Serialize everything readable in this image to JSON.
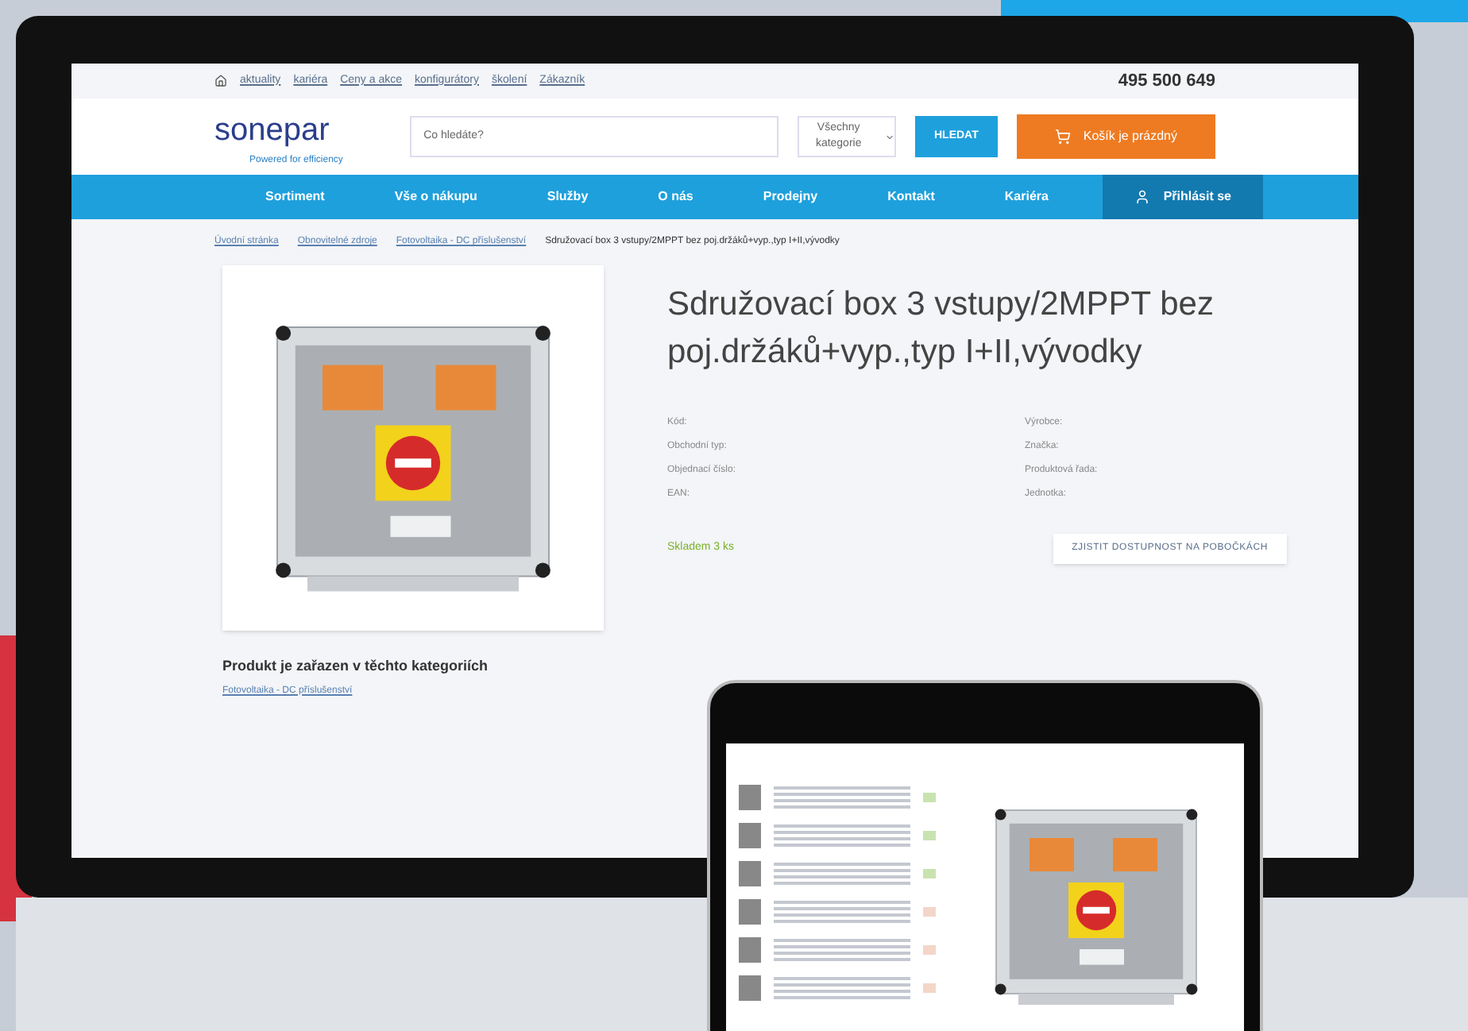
{
  "top_links": [
    "aktuality",
    "kariéra",
    "Ceny a akce",
    "konfigurátory",
    "školení",
    "Zákazník"
  ],
  "phone": "495 500 649",
  "logo": {
    "name": "sonepar",
    "tagline": "Powered for efficiency"
  },
  "search": {
    "placeholder": "Co hledáte?",
    "category": "Všechny kategorie",
    "button": "HLEDAT"
  },
  "cart": {
    "label": "Košík je prázdný"
  },
  "nav": [
    {
      "label": "Sortiment",
      "selected": false
    },
    {
      "label": "Vše o nákupu",
      "selected": false
    },
    {
      "label": "Služby",
      "selected": false
    },
    {
      "label": "O nás",
      "selected": false
    },
    {
      "label": "Prodejny",
      "selected": false
    },
    {
      "label": "Kontakt",
      "selected": false
    },
    {
      "label": "Kariéra",
      "selected": false
    }
  ],
  "login": "Přihlásit se",
  "breadcrumb": [
    "Úvodní stránka",
    "Obnovitelné zdroje",
    "Fotovoltaika - DC příslušenství",
    "Sdružovací box 3 vstupy/2MPPT bez poj.držáků+vyp.,typ I+II,vývodky"
  ],
  "product": {
    "title": "Sdružovací box 3 vstupy/2MPPT bez poj.držáků+vyp.,typ I+II,vývodky",
    "details_left": [
      "Kód:",
      "Obchodní typ:",
      "Objednací číslo:",
      "EAN:"
    ],
    "details_right": [
      "Výrobce:",
      "Značka:",
      "Produktová řada:",
      "Jednotka:"
    ],
    "stock": "Skladem 3 ks",
    "availability_button": "ZJISTIT DOSTUPNOST NA POBOČKÁCH"
  },
  "categories": {
    "heading": "Produkt je zařazen v těchto kategoriích",
    "links": [
      "Fotovoltaika - DC příslušenství"
    ]
  },
  "tablet": {
    "items": [
      {
        "in_stock": true
      },
      {
        "in_stock": true
      },
      {
        "in_stock": true
      },
      {
        "in_stock": false
      },
      {
        "in_stock": false
      },
      {
        "in_stock": false
      }
    ]
  }
}
